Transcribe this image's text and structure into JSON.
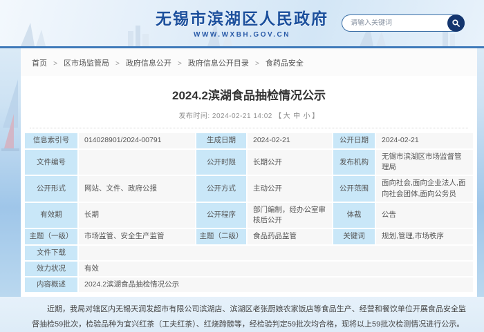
{
  "banner": {
    "site_title": "无锡市滨湖区人民政府",
    "site_url": "WWW.WXBH.GOV.CN",
    "search_placeholder": "请输入关键词"
  },
  "breadcrumb": {
    "separator": ">",
    "items": [
      "首页",
      "区市场监管局",
      "政府信息公开",
      "政府信息公开目录",
      "食药品安全"
    ]
  },
  "article": {
    "title": "2024.2滨湖食品抽检情况公示",
    "publish_label": "发布时间: ",
    "publish_time": "2024-02-21 14:02",
    "font_controls_open": "【",
    "font_controls_close": "】",
    "font_sizes": [
      "大",
      "中",
      "小"
    ],
    "body": "近期，我局对辖区内无锡天润发超市有限公司滨湖店、滨湖区老张厨娘农家饭店等食品生产、经营和餐饮单位开展食品安全监督抽检59批次，检验品种为宜兴红茶（工夫红茶）、红烧蹄髈等，经检验判定59批次均合格，现将以上59批次检测情况进行公示。"
  },
  "meta": {
    "index_label": "信息索引号",
    "index_value": "014028901/2024-00791",
    "gen_date_label": "生成日期",
    "gen_date_value": "2024-02-21",
    "open_date_label": "公开日期",
    "open_date_value": "2024-02-21",
    "doc_no_label": "文件编号",
    "doc_no_value": "",
    "open_term_label": "公开时限",
    "open_term_value": "长期公开",
    "publisher_label": "发布机构",
    "publisher_value": "无锡市滨湖区市场监督管理局",
    "open_form_label": "公开形式",
    "open_form_value": "网站、文件、政府公报",
    "open_mode_label": "公开方式",
    "open_mode_value": "主动公开",
    "open_scope_label": "公开范围",
    "open_scope_value": "面向社会,面向企业法人,面向社会团体,面向公务员",
    "validity_label": "有效期",
    "validity_value": "长期",
    "procedure_label": "公开程序",
    "procedure_value": "部门编制，经办公室审核后公开",
    "genre_label": "体裁",
    "genre_value": "公告",
    "topic1_label": "主题（一级）",
    "topic1_value": "市场监管、安全生产监管",
    "topic2_label": "主题（二级）",
    "topic2_value": "食品药品监管",
    "keywords_label": "关键词",
    "keywords_value": "规划,管理,市场秩序",
    "download_label": "文件下载",
    "download_value": "",
    "effect_label": "效力状况",
    "effect_value": "有效",
    "summary_label": "内容概述",
    "summary_value": "2024.2滨湖食品抽检情况公示"
  },
  "colors": {
    "accent_blue": "#3e79b9",
    "banner_title_blue": "#1b4f9c",
    "label_cell_bg": "#c9e7f8",
    "value_cell_bg": "#f7f7f7",
    "search_button_bg": "#14356e"
  }
}
